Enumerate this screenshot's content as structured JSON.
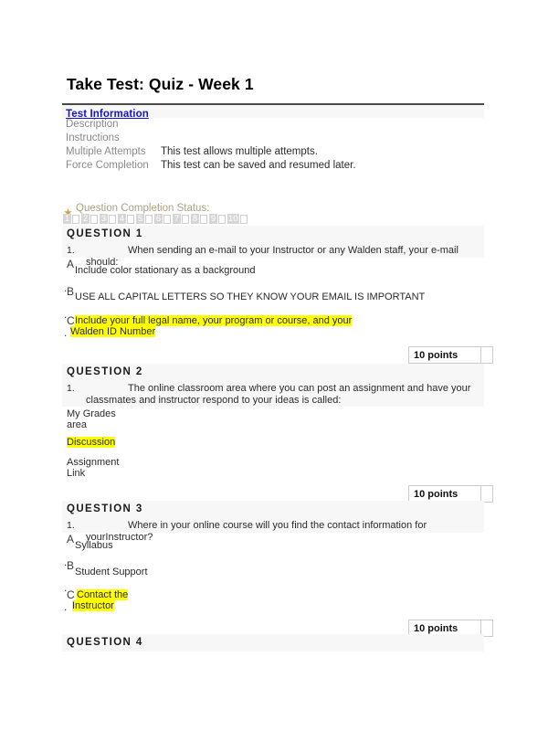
{
  "page": {
    "title": "Take Test: Quiz - Week 1"
  },
  "test_information": {
    "heading": "Test Information",
    "rows": [
      {
        "label": "Description",
        "value": ""
      },
      {
        "label": "Instructions",
        "value": ""
      },
      {
        "label": "Multiple Attempts",
        "value": "This test allows multiple attempts."
      },
      {
        "label": "Force Completion",
        "value": "This test can be saved and resumed later."
      }
    ]
  },
  "completion_status": {
    "icon": "star-icon",
    "label": "Question Completion Status:",
    "questions": [
      "1",
      "2",
      "3",
      "4",
      "5",
      "6",
      "7",
      "8",
      "9",
      "10"
    ]
  },
  "questions": [
    {
      "header": "QUESTION 1",
      "number": "1.",
      "text": "When sending an e-mail to your Instructor or any Walden staff, your e-mail should:",
      "points": "10 points",
      "options": [
        {
          "letter": "A",
          "dot": ".",
          "text": "Include color stationary as a background",
          "highlighted": false
        },
        {
          "letter": "B",
          "dot": ".",
          "text": "USE ALL CAPITAL LETTERS SO THEY KNOW YOUR EMAIL IS IMPORTANT",
          "highlighted": false
        },
        {
          "letter": "C",
          "dot": ".",
          "text_line1": "Include your full legal name, your program or course, and your",
          "text_line2": "Walden ID Number",
          "highlighted": true
        }
      ]
    },
    {
      "header": "QUESTION 2",
      "number": "1.",
      "text": "The online classroom area where you can post an assignment and have your classmates and instructor respond to your ideas is called:",
      "points": "10 points",
      "options": [
        {
          "letter": "",
          "dot": "",
          "text_line1": "My Grades",
          "text_line2": "area",
          "highlighted": false
        },
        {
          "letter": "",
          "dot": "",
          "text_line1": "Discussion",
          "text_line2": "",
          "highlighted": true
        },
        {
          "letter": "",
          "dot": "",
          "text_line1": "Assignment",
          "text_line2": "Link",
          "highlighted": false
        }
      ]
    },
    {
      "header": "QUESTION 3",
      "number": "1.",
      "text": "Where in your online course will you find the contact information for yourInstructor?",
      "points": "10 points",
      "options": [
        {
          "letter": "A",
          "dot": ".",
          "text": "Syllabus",
          "highlighted": false
        },
        {
          "letter": "B",
          "dot": ".",
          "text": "Student Support",
          "highlighted": false
        },
        {
          "letter": "C",
          "dot": ".",
          "text_line1": "Contact the",
          "text_line2": "Instructor",
          "highlighted": true
        }
      ]
    },
    {
      "header": "QUESTION 4",
      "number": "",
      "text": "",
      "points": "",
      "options": []
    }
  ],
  "colors": {
    "link": "#1414cc",
    "band": "#f7f7f7",
    "highlight": "#ffff00",
    "label_gray": "#8a8a8a",
    "status_text": "#b0a080"
  }
}
